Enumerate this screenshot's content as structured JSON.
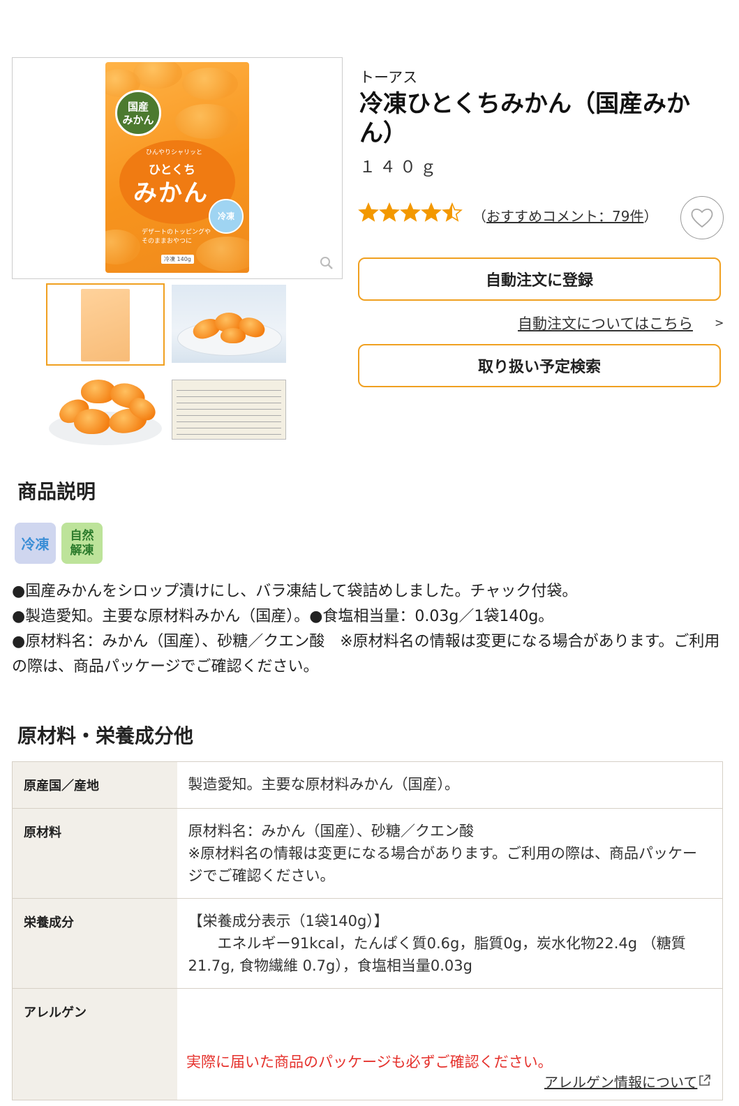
{
  "product": {
    "brand": "トーアス",
    "title": "冷凍ひとくちみかん（国産みかん）",
    "amount": "１４０ｇ",
    "rating": 4.5,
    "rating_max": 5,
    "review_label": "おすすめコメント：79件",
    "review_open": "（",
    "review_close": "）"
  },
  "package_image": {
    "badge": "国産\nみかん",
    "small_text": "ひんやりシャリッと",
    "title_a": "ひとくち",
    "title_b": "みかん",
    "ice_label": "冷凍",
    "sub_text_1": "デザートのトッピングや",
    "sub_text_2": "そのままおやつに",
    "weight": "冷凍 140g"
  },
  "buttons": {
    "auto_order": "自動注文に登録",
    "auto_order_info": "自動注文についてはこちら",
    "auto_order_info_arrow": ">",
    "handling_search": "取り扱い予定検索"
  },
  "description": {
    "heading": "商品説明",
    "icon_frozen": "冷凍",
    "icon_thaw": "自然\n解凍",
    "text": "●国産みかんをシロップ漬けにし、バラ凍結して袋詰めしました。チャック付袋。\n●製造愛知。主要な原材料みかん（国産）。●食塩相当量：0.03g／1袋140g。\n●原材料名：みかん（国産）、砂糖／クエン酸　※原材料名の情報は変更になる場合があります。ご利用の際は、商品パッケージでご確認ください。"
  },
  "nutrition": {
    "heading": "原材料・栄養成分他",
    "rows": [
      {
        "label": "原産国／産地",
        "value": "製造愛知。主要な原材料みかん（国産）。"
      },
      {
        "label": "原材料",
        "value": "原材料名：みかん（国産）、砂糖／クエン酸\n※原材料名の情報は変更になる場合があります。ご利用の際は、商品パッケージでご確認ください。"
      },
      {
        "label": "栄養成分",
        "value": "【栄養成分表示（1袋140g）】\n　　エネルギー91kcal，たんぱく質0.6g，脂質0g，炭水化物22.4g （糖質21.7g, 食物繊維 0.7g），食塩相当量0.03g"
      },
      {
        "label": "アレルゲン",
        "value": ""
      }
    ],
    "warning": "実際に届いた商品のパッケージも必ずご確認ください。",
    "allergy_link": "アレルゲン情報について"
  },
  "colors": {
    "accent": "#f0a020",
    "star": "#f39800",
    "warning": "#e5322d",
    "table_label_bg": "#f2efe9"
  }
}
